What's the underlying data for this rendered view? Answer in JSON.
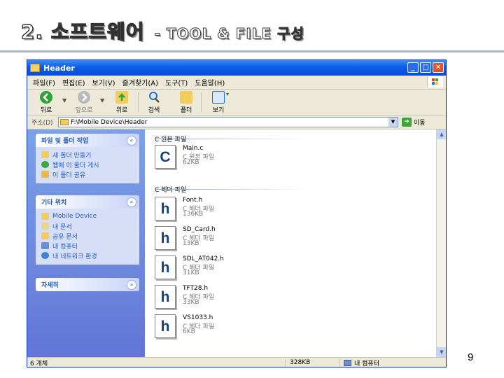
{
  "slide": {
    "title": "2. 소프트웨어",
    "subtitle": "- TOOL & FILE 구성",
    "page_number": "9"
  },
  "window": {
    "title": "Header",
    "controls": {
      "minimize": "_",
      "maximize": "□",
      "close": "✕"
    },
    "menu": [
      "파일(F)",
      "편집(E)",
      "보기(V)",
      "즐겨찾기(A)",
      "도구(T)",
      "도움말(H)"
    ],
    "toolbar": [
      {
        "label": "뒤로",
        "icon": "back-icon",
        "enabled": true
      },
      {
        "label": "앞으로",
        "icon": "forward-icon",
        "enabled": false
      },
      {
        "label": "위로",
        "icon": "up-folder-icon",
        "enabled": true
      },
      {
        "label": "검색",
        "icon": "search-icon",
        "enabled": true
      },
      {
        "label": "폴더",
        "icon": "folders-icon",
        "enabled": true
      },
      {
        "label": "보기",
        "icon": "views-icon",
        "enabled": true
      }
    ],
    "address": {
      "label": "주소(D)",
      "path": "F:\\Mobile Device\\Header",
      "go_label": "이동"
    },
    "tasks": {
      "file_folder": {
        "title": "파일 및 폴더 작업",
        "toggle": "«",
        "items": [
          "새 폴더 만들기",
          "웹에 이 폴더 게시",
          "이 폴더 공유"
        ]
      },
      "other_places": {
        "title": "기타 위치",
        "toggle": "«",
        "items": [
          "Mobile Device",
          "내 문서",
          "공유 문서",
          "내 컴퓨터",
          "내 네트워크 환경"
        ]
      },
      "details": {
        "title": "자세히",
        "toggle": "»"
      }
    },
    "groups": [
      {
        "title": "C 원본 파일",
        "files": [
          {
            "name": "Main.c",
            "type": "C 원본 파일",
            "size": "62KB",
            "letter": "C"
          }
        ]
      },
      {
        "title": "C 헤더 파일",
        "files": [
          {
            "name": "Font.h",
            "type": "C 헤더 파일",
            "size": "136KB",
            "letter": "h"
          },
          {
            "name": "SD_Card.h",
            "type": "C 헤더 파일",
            "size": "13KB",
            "letter": "h"
          },
          {
            "name": "SDL_AT042.h",
            "type": "C 헤더 파일",
            "size": "31KB",
            "letter": "h"
          },
          {
            "name": "TFT28.h",
            "type": "C 헤더 파일",
            "size": "33KB",
            "letter": "h"
          },
          {
            "name": "VS1033.h",
            "type": "C 헤더 파일",
            "size": "6KB",
            "letter": "h"
          }
        ]
      }
    ],
    "status": {
      "count": "6 개체",
      "total_size": "328KB",
      "location": "내 컴퓨터"
    }
  },
  "colors": {
    "titlebar": "#0a5ce8",
    "taskpane": "#6f8fdf",
    "task_link": "#215dc6",
    "title_rule": "#a9b6c7"
  }
}
